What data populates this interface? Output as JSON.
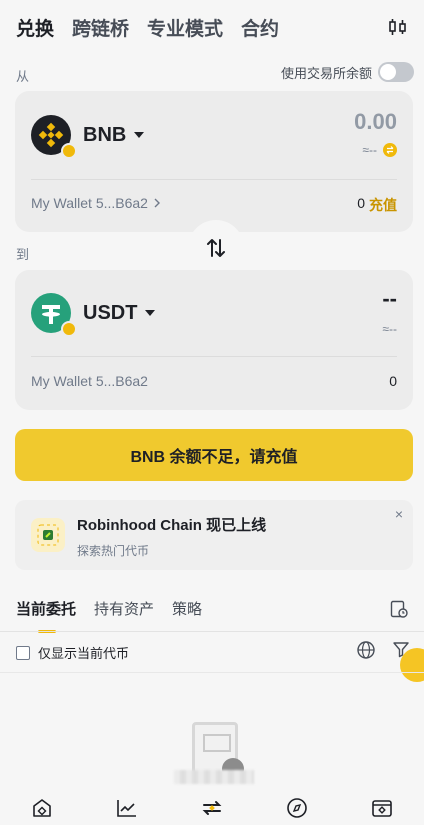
{
  "top_tabs": [
    "兑换",
    "跨链桥",
    "专业模式",
    "合约"
  ],
  "from_label": "从",
  "to_label": "到",
  "use_exchange_balance": "使用交易所余额",
  "from": {
    "token": "BNB",
    "amount": "0.00",
    "sub": "≈--",
    "wallet": "My Wallet 5...B6a2",
    "balance": "0",
    "recharge": "充值"
  },
  "to": {
    "token": "USDT",
    "amount": "--",
    "sub": "≈--",
    "wallet": "My Wallet 5...B6a2",
    "balance": "0"
  },
  "cta": "BNB 余额不足，请充值",
  "promo": {
    "title": "Robinhood Chain 现已上线",
    "subtitle": "探索热门代币",
    "close": "×"
  },
  "order_tabs": [
    "当前委托",
    "持有资产",
    "策略"
  ],
  "filter_label": "仅显示当前代币",
  "colors": {
    "accent": "#f0b90b",
    "cta": "#f0c92e",
    "recharge": "#c99400",
    "usdt": "#26a17b"
  }
}
